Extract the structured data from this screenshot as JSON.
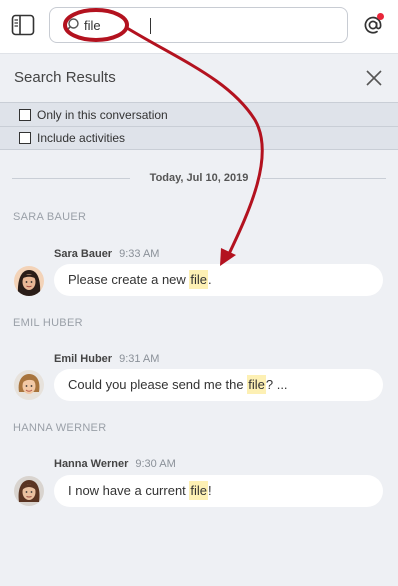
{
  "search": {
    "value": "file"
  },
  "results": {
    "title": "Search Results",
    "filters": [
      {
        "label": "Only in this conversation"
      },
      {
        "label": "Include activities"
      }
    ],
    "date": "Today, Jul 10, 2019"
  },
  "groups": [
    {
      "section": "SARA BAUER",
      "name": "Sara Bauer",
      "time": "9:33 AM",
      "before": "Please create a new ",
      "match": "file",
      "after": "."
    },
    {
      "section": "EMIL HUBER",
      "name": "Emil Huber",
      "time": "9:31 AM",
      "before": "Could you please send me the ",
      "match": "file",
      "after": "? ..."
    },
    {
      "section": "HANNA WERNER",
      "name": "Hanna Werner",
      "time": "9:30 AM",
      "before": "I now have a current ",
      "match": "file",
      "after": "!"
    }
  ],
  "colors": {
    "accent_red": "#b3121f",
    "notification_dot": "#e8263a",
    "highlight": "#fdf0b4",
    "background": "#eef0f4"
  },
  "icons": {
    "panel_toggle": "sidebar-panel-icon",
    "search": "search-icon",
    "mention": "at-sign-icon",
    "close": "close-icon"
  }
}
